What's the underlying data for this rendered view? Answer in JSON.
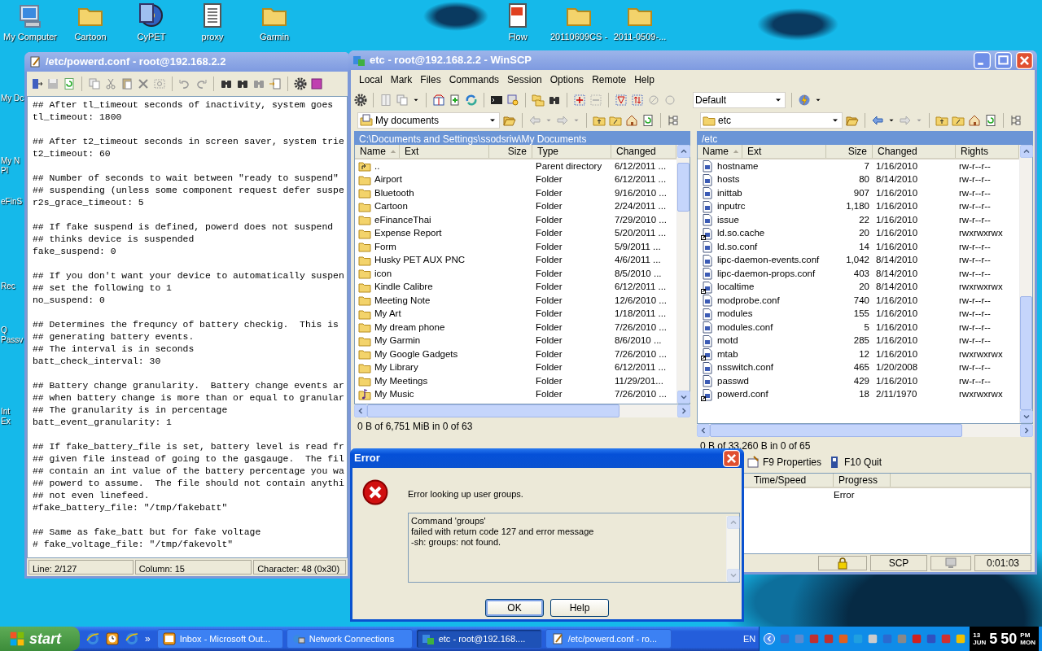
{
  "desktop": {
    "icons": [
      {
        "label": "My Computer"
      },
      {
        "label": "Cartoon"
      },
      {
        "label": "CyPET"
      },
      {
        "label": "proxy"
      },
      {
        "label": "Garmin"
      },
      {
        "label": "Flow"
      },
      {
        "label": "20110609CS -"
      },
      {
        "label": "2011-0509-..."
      }
    ],
    "edge_labels": [
      {
        "lines": [
          "My Dc"
        ]
      },
      {
        "lines": [
          "My N",
          "Pl"
        ]
      },
      {
        "lines": [
          "eFinS"
        ]
      },
      {
        "lines": [
          "Rec"
        ]
      },
      {
        "lines": [
          "Q",
          "Passv"
        ]
      },
      {
        "lines": [
          "Int",
          "Ex"
        ]
      }
    ]
  },
  "editor": {
    "title": "/etc/powerd.conf - root@192.168.2.2",
    "paragraphs": [
      [
        "## After tl_timeout seconds of inactivity, system goes",
        "tl_timeout: 1800"
      ],
      [
        "## After t2_timeout seconds in screen saver, system trie",
        "t2_timeout: 60"
      ],
      [
        "## Number of seconds to wait between \"ready to suspend\"",
        "## suspending (unless some component request defer suspe",
        "r2s_grace_timeout: 5"
      ],
      [
        "## If fake suspend is defined, powerd does not suspend",
        "## thinks device is suspended",
        "fake_suspend: 0"
      ],
      [
        "## If you don't want your device to automatically suspen",
        "## set the following to 1",
        "no_suspend: 0"
      ],
      [
        "## Determines the frequncy of battery checkig.  This is",
        "## generating battery events.",
        "## The interval is in seconds",
        "batt_check_interval: 30"
      ],
      [
        "## Battery change granularity.  Battery change events ar",
        "## when battery change is more than or equal to granular",
        "## The granularity is in percentage",
        "batt_event_granularity: 1"
      ],
      [
        "## If fake_battery_file is set, battery level is read fr",
        "## given file instead of going to the gasgauge.  The fil",
        "## contain an int value of the battery percentage you wa",
        "## powerd to assume.  The file should not contain anythi",
        "## not even linefeed.",
        "#fake_battery_file: \"/tmp/fakebatt\""
      ],
      [
        "## Same as fake_batt but for fake voltage",
        "# fake_voltage_file: \"/tmp/fakevolt\""
      ]
    ],
    "status_bar": [
      "Line: 2/127",
      "Column: 15",
      "Character: 48 (0x30)"
    ]
  },
  "winscp": {
    "title": "etc - root@192.168.2.2 - WinSCP",
    "menu": [
      "Local",
      "Mark",
      "Files",
      "Commands",
      "Session",
      "Options",
      "Remote",
      "Help"
    ],
    "profile": "Default",
    "panels": [
      {
        "location": "My documents",
        "path": "C:\\Documents and Settings\\ssodsriw\\My Documents",
        "columns": [
          "Name",
          "Ext",
          "Size",
          "Type",
          "Changed"
        ],
        "rows": [
          {
            "kind": "parent",
            "name": "..",
            "type": "Parent directory",
            "changed": "6/12/2011 ..."
          },
          {
            "kind": "folder",
            "name": "Airport",
            "type": "Folder",
            "changed": "6/12/2011 ..."
          },
          {
            "kind": "folder",
            "name": "Bluetooth",
            "type": "Folder",
            "changed": "9/16/2010 ..."
          },
          {
            "kind": "folder",
            "name": "Cartoon",
            "type": "Folder",
            "changed": "2/24/2011 ..."
          },
          {
            "kind": "folder",
            "name": "eFinanceThai",
            "type": "Folder",
            "changed": "7/29/2010 ..."
          },
          {
            "kind": "folder",
            "name": "Expense Report",
            "type": "Folder",
            "changed": "5/20/2011 ..."
          },
          {
            "kind": "folder",
            "name": "Form",
            "type": "Folder",
            "changed": "5/9/2011 ..."
          },
          {
            "kind": "folder",
            "name": "Husky PET AUX PNC",
            "type": "Folder",
            "changed": "4/6/2011 ..."
          },
          {
            "kind": "folder",
            "name": "icon",
            "type": "Folder",
            "changed": "8/5/2010 ..."
          },
          {
            "kind": "folder",
            "name": "Kindle Calibre",
            "type": "Folder",
            "changed": "6/12/2011 ..."
          },
          {
            "kind": "folder",
            "name": "Meeting Note",
            "type": "Folder",
            "changed": "12/6/2010 ..."
          },
          {
            "kind": "folder",
            "name": "My Art",
            "type": "Folder",
            "changed": "1/18/2011 ..."
          },
          {
            "kind": "folder",
            "name": "My dream phone",
            "type": "Folder",
            "changed": "7/26/2010 ..."
          },
          {
            "kind": "folder",
            "name": "My Garmin",
            "type": "Folder",
            "changed": "8/6/2010 ..."
          },
          {
            "kind": "folder",
            "name": "My Google Gadgets",
            "type": "Folder",
            "changed": "7/26/2010 ..."
          },
          {
            "kind": "folder",
            "name": "My Library",
            "type": "Folder",
            "changed": "6/12/2011 ..."
          },
          {
            "kind": "folder",
            "name": "My Meetings",
            "type": "Folder",
            "changed": "11/29/201..."
          },
          {
            "kind": "music",
            "name": "My Music",
            "type": "Folder",
            "changed": "7/26/2010 ..."
          }
        ],
        "summary": "0 B of 6,751 MiB in 0 of 63"
      },
      {
        "location": "etc",
        "path": "/etc",
        "columns": [
          "Name",
          "Ext",
          "Size",
          "Changed",
          "Rights"
        ],
        "rows": [
          {
            "kind": "file",
            "name": "hostname",
            "size": "7",
            "changed": "1/16/2010",
            "rights": "rw-r--r--"
          },
          {
            "kind": "file",
            "name": "hosts",
            "size": "80",
            "changed": "8/14/2010",
            "rights": "rw-r--r--"
          },
          {
            "kind": "file",
            "name": "inittab",
            "size": "907",
            "changed": "1/16/2010",
            "rights": "rw-r--r--"
          },
          {
            "kind": "file",
            "name": "inputrc",
            "size": "1,180",
            "changed": "1/16/2010",
            "rights": "rw-r--r--"
          },
          {
            "kind": "file",
            "name": "issue",
            "size": "22",
            "changed": "1/16/2010",
            "rights": "rw-r--r--"
          },
          {
            "kind": "link",
            "name": "ld.so.cache",
            "size": "20",
            "changed": "1/16/2010",
            "rights": "rwxrwxrwx"
          },
          {
            "kind": "file",
            "name": "ld.so.conf",
            "size": "14",
            "changed": "1/16/2010",
            "rights": "rw-r--r--"
          },
          {
            "kind": "file",
            "name": "lipc-daemon-events.conf",
            "size": "1,042",
            "changed": "8/14/2010",
            "rights": "rw-r--r--"
          },
          {
            "kind": "file",
            "name": "lipc-daemon-props.conf",
            "size": "403",
            "changed": "8/14/2010",
            "rights": "rw-r--r--"
          },
          {
            "kind": "link",
            "name": "localtime",
            "size": "20",
            "changed": "8/14/2010",
            "rights": "rwxrwxrwx"
          },
          {
            "kind": "file",
            "name": "modprobe.conf",
            "size": "740",
            "changed": "1/16/2010",
            "rights": "rw-r--r--"
          },
          {
            "kind": "file",
            "name": "modules",
            "size": "155",
            "changed": "1/16/2010",
            "rights": "rw-r--r--"
          },
          {
            "kind": "file",
            "name": "modules.conf",
            "size": "5",
            "changed": "1/16/2010",
            "rights": "rw-r--r--"
          },
          {
            "kind": "file",
            "name": "motd",
            "size": "285",
            "changed": "1/16/2010",
            "rights": "rw-r--r--"
          },
          {
            "kind": "link",
            "name": "mtab",
            "size": "12",
            "changed": "1/16/2010",
            "rights": "rwxrwxrwx"
          },
          {
            "kind": "file",
            "name": "nsswitch.conf",
            "size": "465",
            "changed": "1/20/2008",
            "rights": "rw-r--r--"
          },
          {
            "kind": "file",
            "name": "passwd",
            "size": "429",
            "changed": "1/16/2010",
            "rights": "rw-r--r--"
          },
          {
            "kind": "link",
            "name": "powerd.conf",
            "size": "18",
            "changed": "2/11/1970",
            "rights": "rwxrwxrwx"
          }
        ],
        "summary": "0 B of 33,260 B in 0 of 65"
      }
    ],
    "function_keys": [
      "F9 Properties",
      "F10 Quit"
    ],
    "queue": {
      "columns": [
        "Time/Speed",
        "Progress"
      ],
      "rows": [
        {
          "progress": "Error"
        }
      ]
    },
    "status_bar": {
      "protocol": "SCP",
      "elapsed": "0:01:03"
    }
  },
  "dialog": {
    "title": "Error",
    "message": "Error looking up user groups.",
    "details": [
      "Command 'groups'",
      "failed with return code 127 and error message",
      "-sh: groups: not found."
    ],
    "buttons": [
      {
        "label": "OK",
        "default": true
      },
      {
        "label": "Help",
        "default": false
      }
    ]
  },
  "taskbar": {
    "start": "start",
    "more": "»",
    "tasks": [
      {
        "kind": "mail",
        "label": "Inbox - Microsoft Out...",
        "selected": false
      },
      {
        "kind": "network",
        "label": "Network Connections",
        "selected": false
      },
      {
        "kind": "winscp",
        "label": "etc - root@192.168....",
        "selected": true
      },
      {
        "kind": "editor",
        "label": "/etc/powerd.conf - ro...",
        "selected": false
      }
    ],
    "language": "EN",
    "clock": {
      "day": "13",
      "month": "JUN",
      "hour": "5",
      "minute": "50",
      "ampm": "PM",
      "weekday": "MON"
    }
  }
}
